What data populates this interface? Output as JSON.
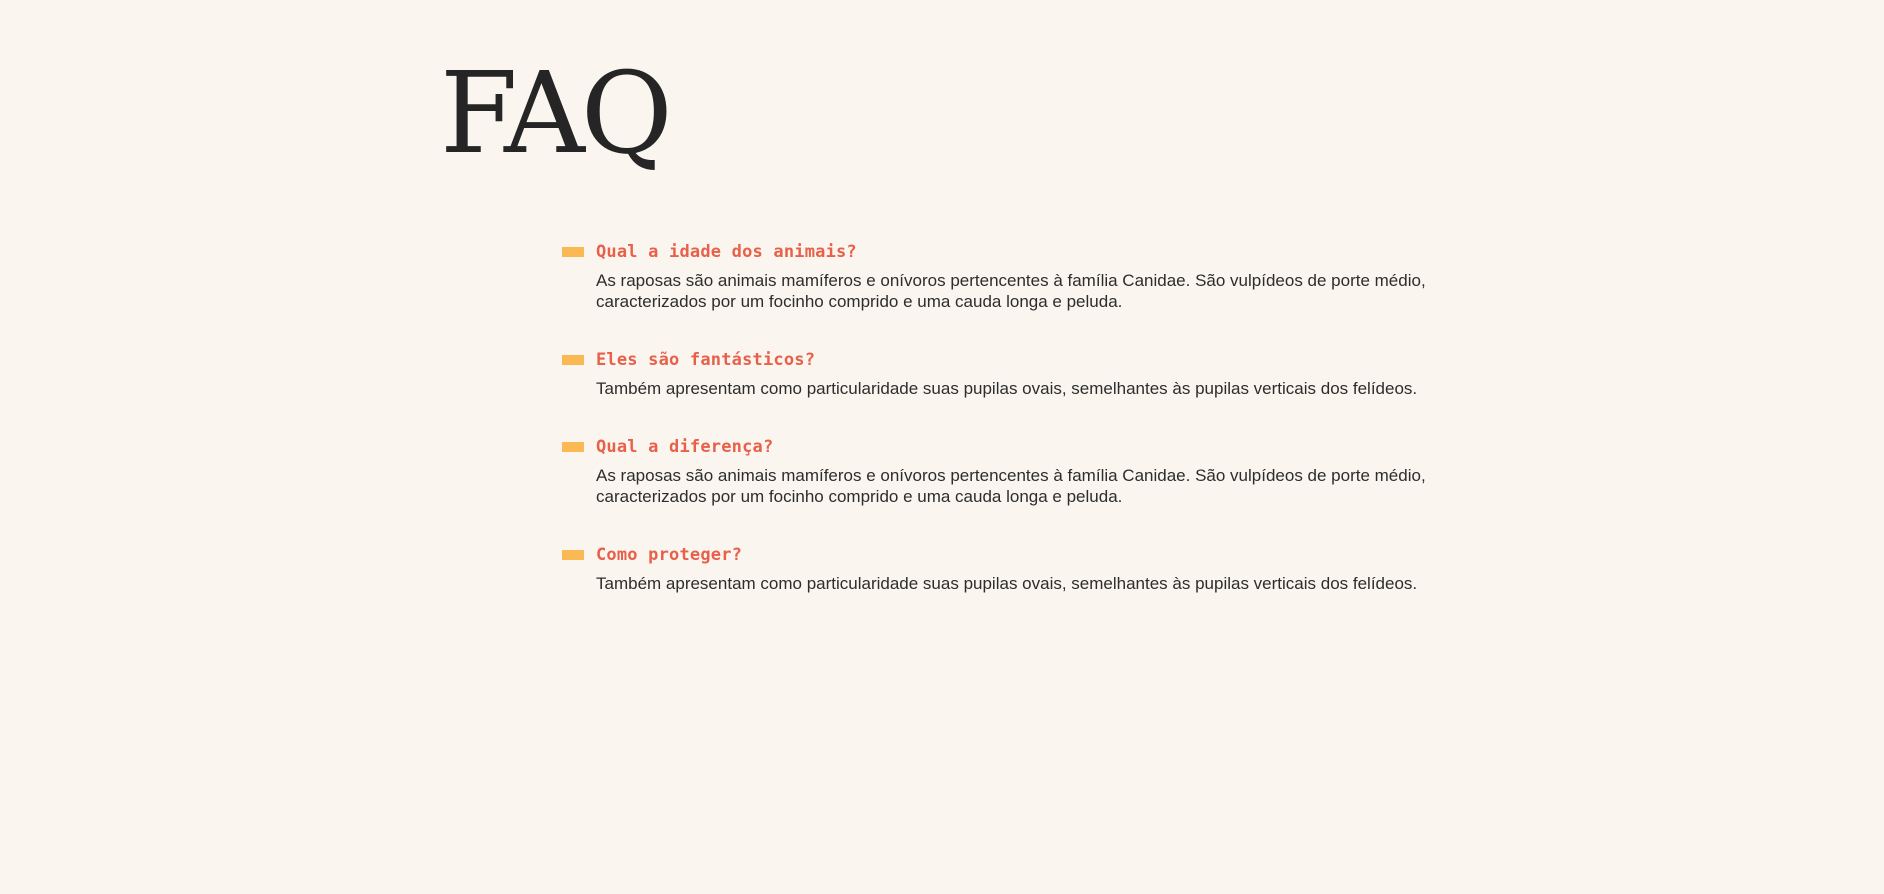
{
  "page": {
    "title": "FAQ"
  },
  "colors": {
    "background": "#faf6ef",
    "title": "#252525",
    "question": "#e8604a",
    "marker": "#fbb954",
    "answer": "#2d2d2d"
  },
  "faq": {
    "items": [
      {
        "question": "Qual a idade dos animais?",
        "answer": "As raposas são animais mamíferos e onívoros pertencentes à família Canidae. São vulpídeos de porte médio, caracterizados por um focinho comprido e uma cauda longa e peluda."
      },
      {
        "question": "Eles são fantásticos?",
        "answer": "Também apresentam como particularidade suas pupilas ovais, semelhantes às pupilas verticais dos felídeos."
      },
      {
        "question": "Qual a diferença?",
        "answer": "As raposas são animais mamíferos e onívoros pertencentes à família Canidae. São vulpídeos de porte médio, caracterizados por um focinho comprido e uma cauda longa e peluda."
      },
      {
        "question": "Como proteger?",
        "answer": "Também apresentam como particularidade suas pupilas ovais, semelhantes às pupilas verticais dos felídeos."
      }
    ]
  }
}
